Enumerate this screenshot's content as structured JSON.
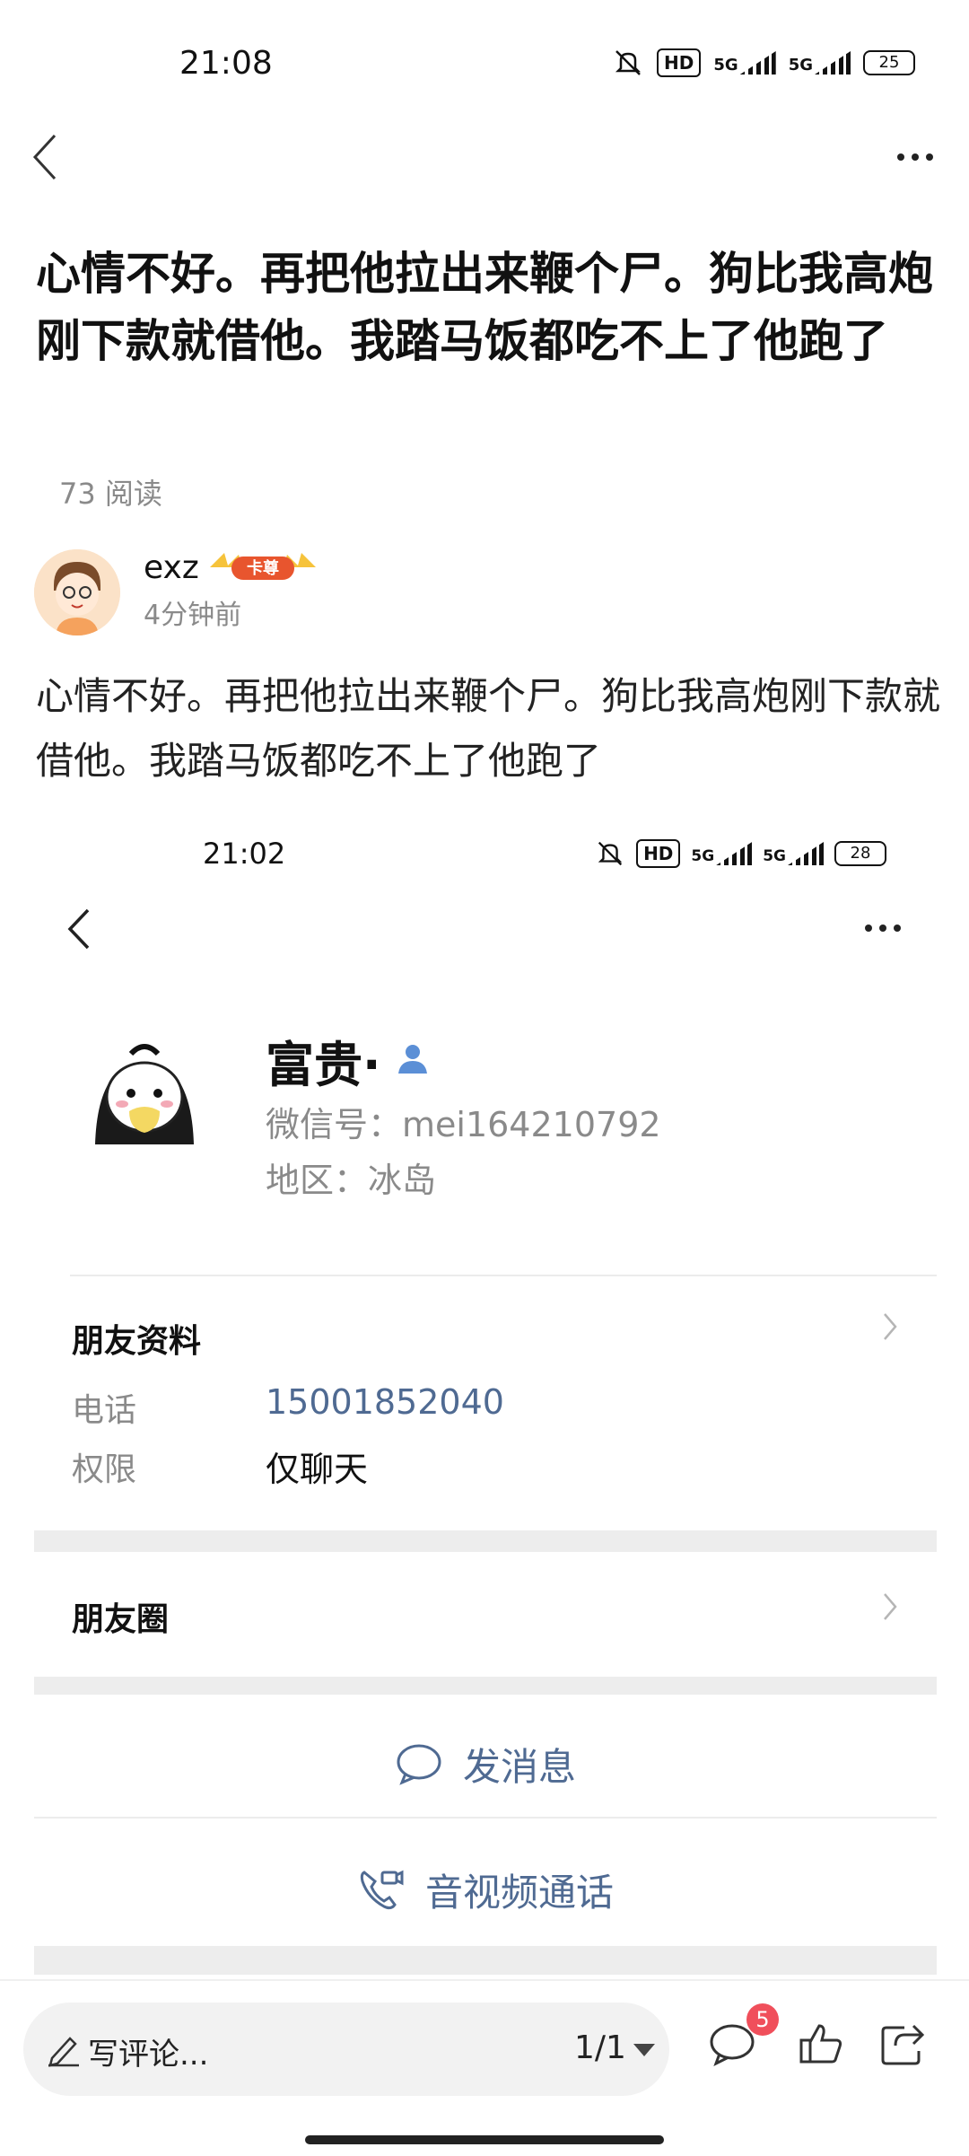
{
  "status_bar": {
    "time": "21:08",
    "hd": "HD",
    "net1": "5G",
    "net2": "5G",
    "battery": "25"
  },
  "nav": {
    "back_icon": "chevron-left-icon",
    "more_icon": "more-dots-icon"
  },
  "post": {
    "title": "心情不好。再把他拉出来鞭个尸。狗比我高炮刚下款就借他。我踏马饭都吃不上了他跑了",
    "reads": "73 阅读",
    "author": "exz",
    "badge": "卡尊",
    "time_ago": "4分钟前",
    "body": "心情不好。再把他拉出来鞭个尸。狗比我高炮刚下款就借他。我踏马饭都吃不上了他跑了"
  },
  "embedded": {
    "status_time": "21:02",
    "hd": "HD",
    "net1": "5G",
    "net2": "5G",
    "battery": "28",
    "name": "富贵·",
    "wechat_id": "微信号：mei164210792",
    "region": "地区：冰岛",
    "friend_info_label": "朋友资料",
    "phone_label": "电话",
    "phone_value": "15001852040",
    "permission_label": "权限",
    "permission_value": "仅聊天",
    "moments_label": "朋友圈",
    "send_message": "发消息",
    "av_call": "音视频通话",
    "colors": {
      "link": "#4f6a92",
      "gray": "#8a8a8a"
    }
  },
  "bottom_bar": {
    "comment_placeholder": "写评论...",
    "pager": "1/1",
    "comment_count_badge": "5",
    "icons": [
      "pencil-icon",
      "comment-icon",
      "like-icon",
      "share-icon"
    ]
  }
}
